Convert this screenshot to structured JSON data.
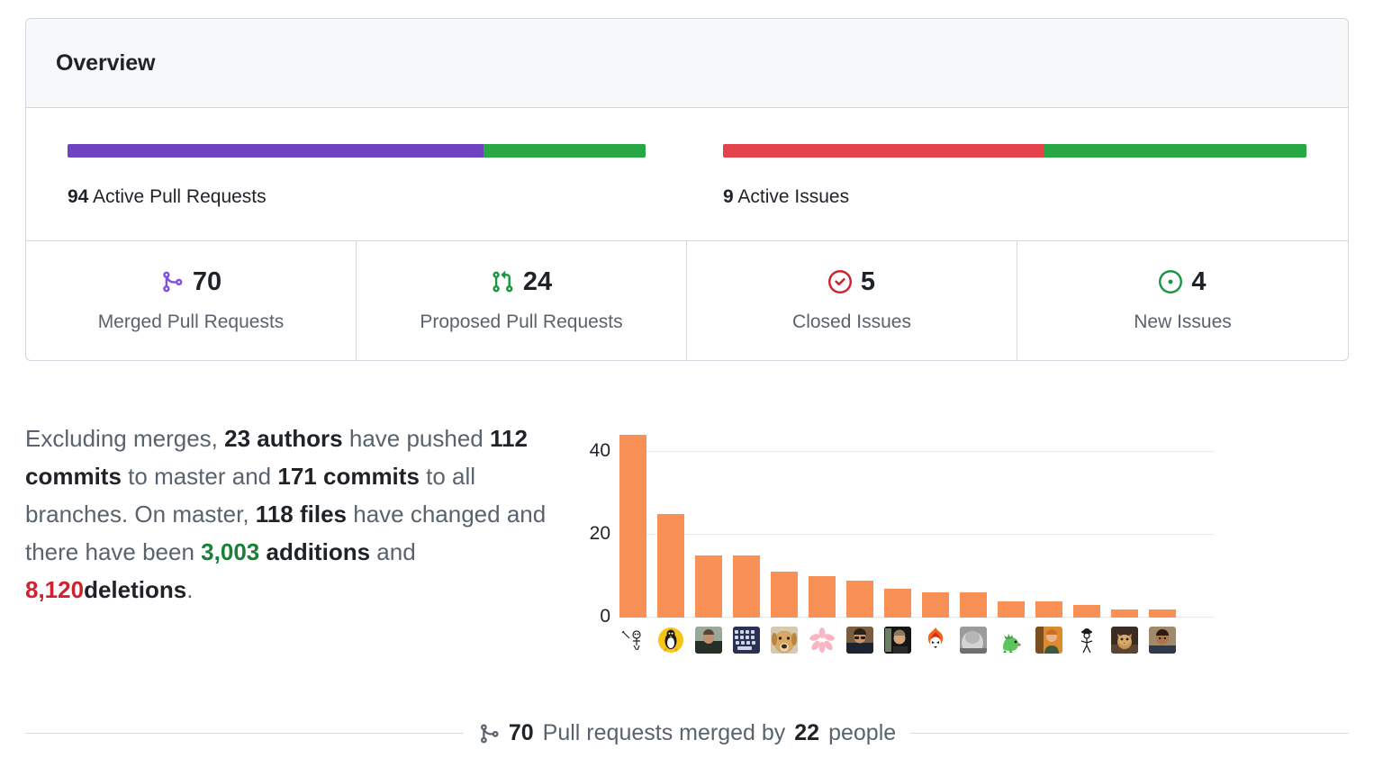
{
  "overview": {
    "title": "Overview",
    "pull_requests": {
      "bar_name": "active-pull-requests-bar",
      "count": "94",
      "label": "Active Pull Requests",
      "merged_pct": 72,
      "proposed_pct": 28,
      "merged_color": "#6f42c1",
      "proposed_color": "#28a745"
    },
    "issues": {
      "bar_name": "active-issues-bar",
      "count": "9",
      "label": "Active Issues",
      "closed_pct": 55,
      "new_pct": 45,
      "closed_color": "#e3444c",
      "new_color": "#28a745"
    },
    "stats": [
      {
        "icon": "git-merge-icon",
        "value": "70",
        "label": "Merged Pull Requests",
        "color": "#8250df"
      },
      {
        "icon": "git-pull-request-icon",
        "value": "24",
        "label": "Proposed Pull Requests",
        "color": "#1a9641"
      },
      {
        "icon": "issue-closed-icon",
        "value": "5",
        "label": "Closed Issues",
        "color": "#cf222e"
      },
      {
        "icon": "issue-opened-icon",
        "value": "4",
        "label": "New Issues",
        "color": "#1a9641"
      }
    ]
  },
  "summary": {
    "lead": "Excluding merges,",
    "authors": "23 authors",
    "have_pushed": "have pushed",
    "commits_master": "112 commits",
    "to_master_and": "to master and",
    "commits_all": "171 commits",
    "to_all_branches": "to all branches. On master,",
    "files": "118 files",
    "have_changed": "have changed and there have been",
    "additions": "3,003",
    "additions_word": "additions",
    "and": "and",
    "deletions": "8,120",
    "deletions_word": "deletions",
    "period": ".",
    "additions_color": "#1a7f37",
    "deletions_color": "#cf222e"
  },
  "chart_data": {
    "type": "bar",
    "title": "",
    "xlabel": "",
    "ylabel": "",
    "ylim": [
      0,
      46
    ],
    "yticks": [
      0,
      20,
      40
    ],
    "grid": true,
    "legend": "none",
    "bar_color": "#f99157",
    "categories": [
      "sketch-avatar",
      "tux-penguin-avatar",
      "person-avatar-1",
      "keyboard-avatar",
      "dog-avatar",
      "cherry-blossom-avatar",
      "person-avatar-2",
      "person-avatar-3",
      "fire-mascot-avatar",
      "grayscale-photo-avatar",
      "dinosaur-avatar",
      "person-avatar-4",
      "stick-figure-avatar",
      "cat-avatar",
      "person-avatar-5"
    ],
    "values": [
      44,
      25,
      15,
      15,
      11,
      10,
      9,
      7,
      6,
      6,
      4,
      4,
      3,
      2,
      2
    ]
  },
  "footer": {
    "icon": "git-merge-icon",
    "count": "70",
    "text_before": "Pull requests merged by",
    "people": "22",
    "text_after": "people"
  }
}
